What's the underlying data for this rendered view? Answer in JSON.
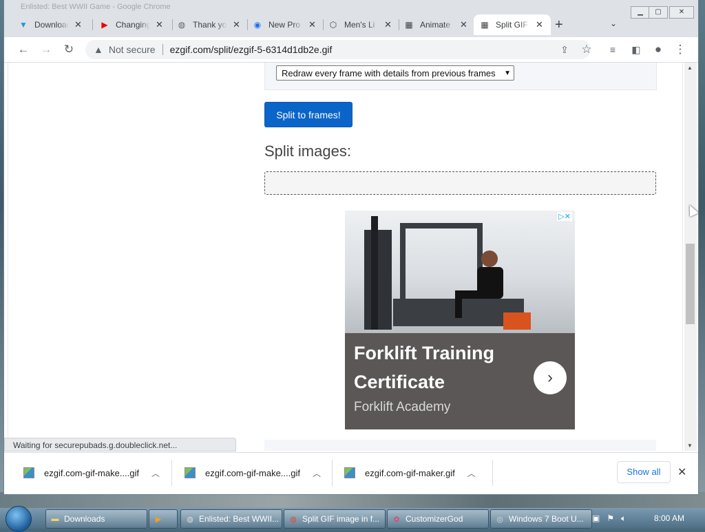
{
  "window": {
    "background_title": "Enlisted: Best WWII Game - Google Chrome"
  },
  "tabs": [
    {
      "label": "Download",
      "icon": "download-arrow-icon",
      "active": false
    },
    {
      "label": "Changing",
      "icon": "youtube-icon",
      "active": false
    },
    {
      "label": "Thank you",
      "icon": "globe-icon",
      "active": false
    },
    {
      "label": "New Pro",
      "icon": "eye-icon",
      "active": false
    },
    {
      "label": "Men's Li",
      "icon": "shield-icon",
      "active": false
    },
    {
      "label": "Animate",
      "icon": "gif-icon",
      "active": false
    },
    {
      "label": "Split GIF",
      "icon": "gif-icon",
      "active": true
    }
  ],
  "toolbar": {
    "security": "Not secure",
    "url": "ezgif.com/split/ezgif-5-6314d1db2e.gif"
  },
  "page": {
    "select_value": "Redraw every frame with details from previous frames",
    "split_button": "Split to frames!",
    "section_title": "Split images:"
  },
  "ad": {
    "title": "Forklift Training Certificate",
    "subtitle": "Forklift Academy",
    "badge": "▷✕"
  },
  "status": "Waiting for securepubads.g.doubleclick.net...",
  "downloads": [
    {
      "name": "ezgif.com-gif-make....gif"
    },
    {
      "name": "ezgif.com-gif-make....gif"
    },
    {
      "name": "ezgif.com-gif-maker.gif"
    }
  ],
  "shelf": {
    "show_all": "Show all"
  },
  "taskbar": {
    "items": [
      {
        "label": "Downloads",
        "icon": "folder-icon"
      },
      {
        "label": "",
        "icon": "media-player-icon"
      },
      {
        "label": "Enlisted: Best WWII...",
        "icon": "chrome-icon"
      },
      {
        "label": "Split GIF image in f...",
        "icon": "chrome-icon"
      },
      {
        "label": "CustomizerGod",
        "icon": "gear-icon"
      },
      {
        "label": "Windows 7 Boot U...",
        "icon": "disk-icon"
      }
    ],
    "clock": "8:00 AM"
  },
  "colors": {
    "accent": "#0b65c8",
    "ad_bg": "#5b5757",
    "tabbar": "#dee1e6"
  }
}
